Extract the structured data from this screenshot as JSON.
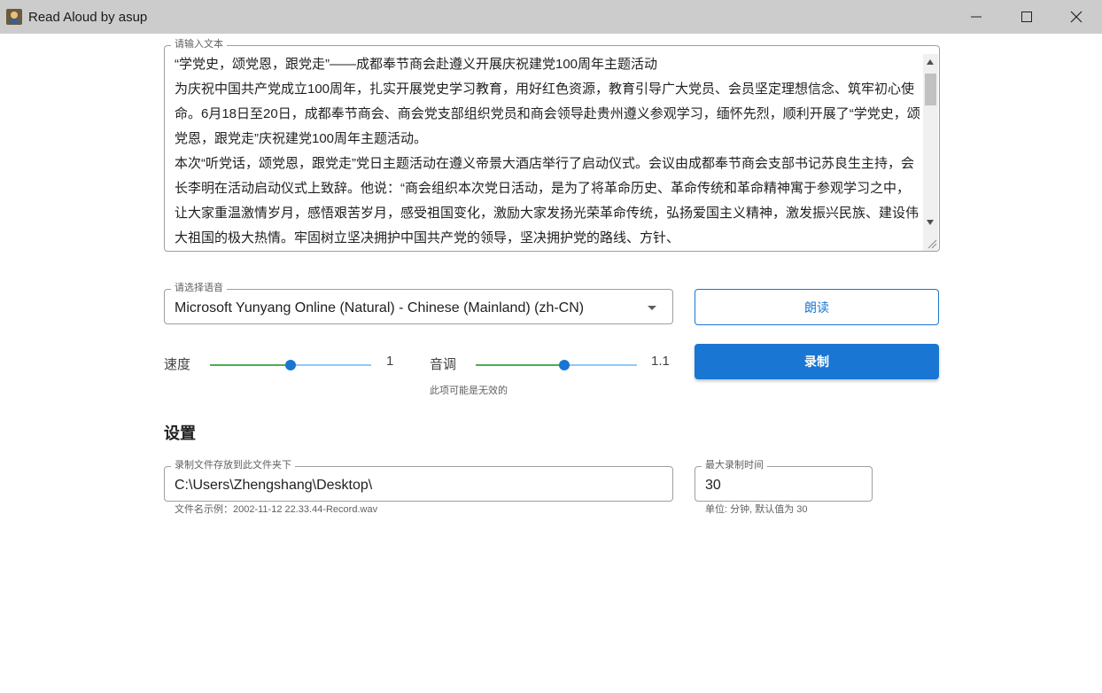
{
  "window": {
    "title": "Read Aloud by asup"
  },
  "text_input": {
    "label": "请输入文本",
    "lines": [
      "“学党史，颂党恩，跟党走”——成都奉节商会赴遵义开展庆祝建党100周年主题活动",
      "为庆祝中国共产党成立100周年，扎实开展党史学习教育，用好红色资源，教育引导广大党员、会员坚定理想信念、筑牢初心使命。6月18日至20日，成都奉节商会、商会党支部组织党员和商会领导赴贵州遵义参观学习，缅怀先烈，顺利开展了“学党史，颂党恩，跟党走”庆祝建党100周年主题活动。",
      "本次“听党话，颂党恩，跟党走”党日主题活动在遵义帝景大酒店举行了启动仪式。会议由成都奉节商会支部书记苏良生主持，会长李明在活动启动仪式上致辞。他说：“商会组织本次党日活动，是为了将革命历史、革命传统和革命精神寓于参观学习之中，让大家重温激情岁月，感悟艰苦岁月，感受祖国变化，激励大家发扬光荣革命传统，弘扬爱国主义精神，激发振兴民族、建设伟大祖国的极大热情。牢固树立坚决拥护中国共产党的领导，坚决拥护党的路线、方针、"
    ]
  },
  "voice": {
    "label": "请选择语音",
    "selected": "Microsoft Yunyang Online (Natural) - Chinese (Mainland) (zh-CN)"
  },
  "actions": {
    "read_label": "朗读",
    "record_label": "录制"
  },
  "speed": {
    "label": "速度",
    "value": "1",
    "fraction": 0.5
  },
  "pitch": {
    "label": "音调",
    "value": "1.1",
    "fraction": 0.55,
    "hint": "此项可能是无效的"
  },
  "settings": {
    "title": "设置",
    "folder": {
      "label": "录制文件存放到此文件夹下",
      "value": "C:\\Users\\Zhengshang\\Desktop\\",
      "hint": "文件名示例：2002-11-12 22.33.44-Record.wav"
    },
    "max_time": {
      "label": "最大录制时间",
      "value": "30",
      "hint": "单位: 分钟, 默认值为 30"
    }
  },
  "colors": {
    "primary": "#1976d2",
    "slider_left": "#4caf50",
    "slider_right": "#90caf9",
    "titlebar": "#cccccc"
  }
}
